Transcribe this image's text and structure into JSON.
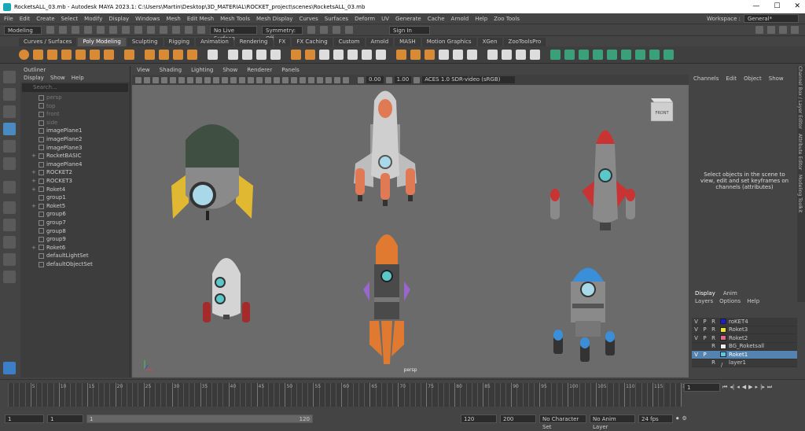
{
  "window": {
    "title": "RocketsALL_03.mb - Autodesk MAYA 2023.1: C:\\Users\\Martin\\Desktop\\3D_MATERIAL\\ROCKET_project\\scenes\\RocketsALL_03.mb",
    "min": "—",
    "max": "☐",
    "close": "✕"
  },
  "menu": [
    "File",
    "Edit",
    "Create",
    "Select",
    "Modify",
    "Display",
    "Windows",
    "Mesh",
    "Edit Mesh",
    "Mesh Tools",
    "Mesh Display",
    "Curves",
    "Surfaces",
    "Deform",
    "UV",
    "Generate",
    "Cache",
    "Arnold",
    "Help",
    "Zoo Tools"
  ],
  "workspace": {
    "label": "Workspace :",
    "value": "General*"
  },
  "status": {
    "mode": "Modeling",
    "live": "No Live Surface",
    "symmetry": "Symmetry: Off",
    "signin": "Sign In"
  },
  "shelf_tabs": [
    "Curves / Surfaces",
    "Poly Modeling",
    "Sculpting",
    "Rigging",
    "Animation",
    "Rendering",
    "FX",
    "FX Caching",
    "Custom",
    "Arnold",
    "MASH",
    "Motion Graphics",
    "XGen",
    "ZooToolsPro"
  ],
  "shelf_active": "Poly Modeling",
  "outliner": {
    "title": "Outliner",
    "menu": [
      "Display",
      "Show",
      "Help"
    ],
    "search_placeholder": "Search...",
    "items": [
      {
        "label": "persp",
        "dim": true,
        "exp": ""
      },
      {
        "label": "top",
        "dim": true,
        "exp": ""
      },
      {
        "label": "front",
        "dim": true,
        "exp": ""
      },
      {
        "label": "side",
        "dim": true,
        "exp": ""
      },
      {
        "label": "imagePlane1",
        "dim": false,
        "exp": ""
      },
      {
        "label": "imagePlane2",
        "dim": false,
        "exp": ""
      },
      {
        "label": "imagePlane3",
        "dim": false,
        "exp": ""
      },
      {
        "label": "RocketBASIC",
        "dim": false,
        "exp": "+"
      },
      {
        "label": "imagePlane4",
        "dim": false,
        "exp": ""
      },
      {
        "label": "ROCKET2",
        "dim": false,
        "exp": "+"
      },
      {
        "label": "ROCKET3",
        "dim": false,
        "exp": "+"
      },
      {
        "label": "Roket4",
        "dim": false,
        "exp": "+"
      },
      {
        "label": "group1",
        "dim": false,
        "exp": ""
      },
      {
        "label": "Roket5",
        "dim": false,
        "exp": "+"
      },
      {
        "label": "group6",
        "dim": false,
        "exp": ""
      },
      {
        "label": "group7",
        "dim": false,
        "exp": ""
      },
      {
        "label": "group8",
        "dim": false,
        "exp": ""
      },
      {
        "label": "group9",
        "dim": false,
        "exp": ""
      },
      {
        "label": "Roket6",
        "dim": false,
        "exp": "+"
      },
      {
        "label": "defaultLightSet",
        "dim": false,
        "exp": ""
      },
      {
        "label": "defaultObjectSet",
        "dim": false,
        "exp": ""
      }
    ]
  },
  "viewport": {
    "menu": [
      "View",
      "Shading",
      "Lighting",
      "Show",
      "Renderer",
      "Panels"
    ],
    "exposure": "0.00",
    "gamma": "1.00",
    "colorspace": "ACES 1.0 SDR-video (sRGB)",
    "camera": "persp",
    "cube_label": "FRONT"
  },
  "channel_box": {
    "menu": [
      "Channels",
      "Edit",
      "Object",
      "Show"
    ],
    "message": "Select objects in the scene to view, edit and set keyframes on channels (attributes)"
  },
  "side_tabs": [
    "Channel Box / Layer Editor",
    "Attribute Editor",
    "Modeling Toolkit"
  ],
  "layers": {
    "tabs": [
      "Display",
      "Anim"
    ],
    "menu": [
      "Layers",
      "Options",
      "Help"
    ],
    "rows": [
      {
        "v": "V",
        "p": "P",
        "r": "R",
        "color": "#1a1ad8",
        "name": "roKET4",
        "sel": false
      },
      {
        "v": "V",
        "p": "P",
        "r": "R",
        "color": "#e8e82a",
        "name": "Roket3",
        "sel": false
      },
      {
        "v": "V",
        "p": "P",
        "r": "R",
        "color": "#e06a8a",
        "name": "Roket2",
        "sel": false
      },
      {
        "v": "",
        "p": "",
        "r": "R",
        "color": "#eeeeee",
        "name": "BG_Roketsall",
        "sel": false
      },
      {
        "v": "V",
        "p": "P",
        "r": "",
        "color": "#5ac8e0",
        "name": "Roket1",
        "sel": true
      },
      {
        "v": "",
        "p": "",
        "r": "R",
        "color": "",
        "name": "layer1",
        "sel": false
      }
    ]
  },
  "timeline": {
    "ticks": [
      "5",
      "10",
      "15",
      "20",
      "25",
      "30",
      "35",
      "40",
      "45",
      "50",
      "55",
      "60",
      "65",
      "70",
      "75",
      "80",
      "85",
      "90",
      "95",
      "100",
      "105",
      "110",
      "115",
      "120"
    ],
    "current": "1"
  },
  "range": {
    "start": "1",
    "start2": "1",
    "inner_start": "1",
    "inner_end": "120",
    "end": "120",
    "end2": "200",
    "character": "No Character Set",
    "anim_layer": "No Anim Layer",
    "fps": "24 fps"
  }
}
